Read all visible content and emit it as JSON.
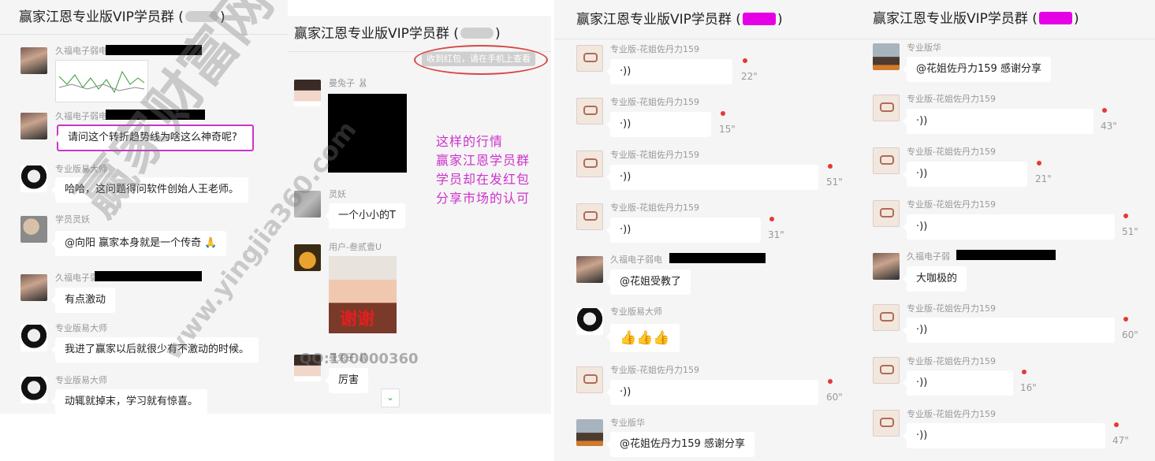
{
  "panel1": {
    "title_prefix": "赢家江恩专业版VIP学员群 (",
    "title_suffix": ")",
    "messages": [
      {
        "name": "久福电子弱电",
        "type": "image"
      },
      {
        "name": "久福电子弱电",
        "text": "请问这个转折趋势线为啥这么神奇呢?"
      },
      {
        "name": "专业版易大师",
        "text": "哈哈，这问题得问软件创始人王老师。"
      },
      {
        "name": "学员灵妖",
        "text": "@向阳 赢家本身就是一个传奇 🙏"
      },
      {
        "name": "久福电子弱",
        "text": "有点激动"
      },
      {
        "name": "专业版易大师",
        "text": "我进了赢家以后就很少有不激动的时候。"
      },
      {
        "name": "专业版易大师",
        "text": "动辄就掉末，学习就有惊喜。"
      }
    ]
  },
  "panel2": {
    "title_prefix": "赢家江恩专业版VIP学员群 (",
    "title_suffix": ")",
    "notice": "收到红包，请在手机上查看",
    "messages": [
      {
        "name": "曼兔子 🐰",
        "type": "image"
      },
      {
        "name": "灵妖",
        "text": "一个小小的T"
      },
      {
        "name": "用户-叁贰壹U",
        "type": "image",
        "caption": "谢谢"
      },
      {
        "name": "曼兔子 🐰",
        "text": "厉害"
      }
    ],
    "scroll_icon": "chevron-down-icon"
  },
  "annotation": {
    "lines": [
      "这样的行情",
      "赢家江恩学员群",
      "学员却在发红包",
      "分享市场的认可"
    ]
  },
  "watermark": {
    "brand": "赢家财富网",
    "url": "www.yingjia360.com",
    "qq": "QQ:100000360"
  },
  "panel3": {
    "title_prefix": "赢家江恩专业版VIP学员群 (",
    "title_suffix": ")",
    "messages": [
      {
        "name": "专业版-花姐佐丹力159",
        "type": "voice",
        "duration": "22\""
      },
      {
        "name": "专业版-花姐佐丹力159",
        "type": "voice",
        "duration": "15\""
      },
      {
        "name": "专业版-花姐佐丹力159",
        "type": "voice",
        "duration": "51\""
      },
      {
        "name": "专业版-花姐佐丹力159",
        "type": "voice",
        "duration": "31\""
      },
      {
        "name": "久福电子弱电",
        "text": "@花姐受教了"
      },
      {
        "name": "专业版易大师",
        "text": "👍👍👍"
      },
      {
        "name": "专业版-花姐佐丹力159",
        "type": "voice",
        "duration": "60\""
      },
      {
        "name": "专业版华",
        "text": "@花姐佐丹力159 感谢分享"
      }
    ]
  },
  "panel4": {
    "title_prefix": "赢家江恩专业版VIP学员群 (",
    "title_suffix": ")",
    "messages": [
      {
        "name": "专业版华",
        "text": "@花姐佐丹力159 感谢分享"
      },
      {
        "name": "专业版-花姐佐丹力159",
        "type": "voice",
        "duration": "43\""
      },
      {
        "name": "专业版-花姐佐丹力159",
        "type": "voice",
        "duration": "21\""
      },
      {
        "name": "专业版-花姐佐丹力159",
        "type": "voice",
        "duration": "51\""
      },
      {
        "name": "久福电子弱",
        "text": "大咖极的"
      },
      {
        "name": "专业版-花姐佐丹力159",
        "type": "voice",
        "duration": "60\""
      },
      {
        "name": "专业版-花姐佐丹力159",
        "type": "voice",
        "duration": "16\""
      },
      {
        "name": "专业版-花姐佐丹力159",
        "type": "voice",
        "duration": "47\""
      }
    ]
  },
  "voice_glyph": "·))",
  "colors": {
    "highlight": "#cc33cc",
    "mask": "#e600e6",
    "unread": "#e53935"
  }
}
